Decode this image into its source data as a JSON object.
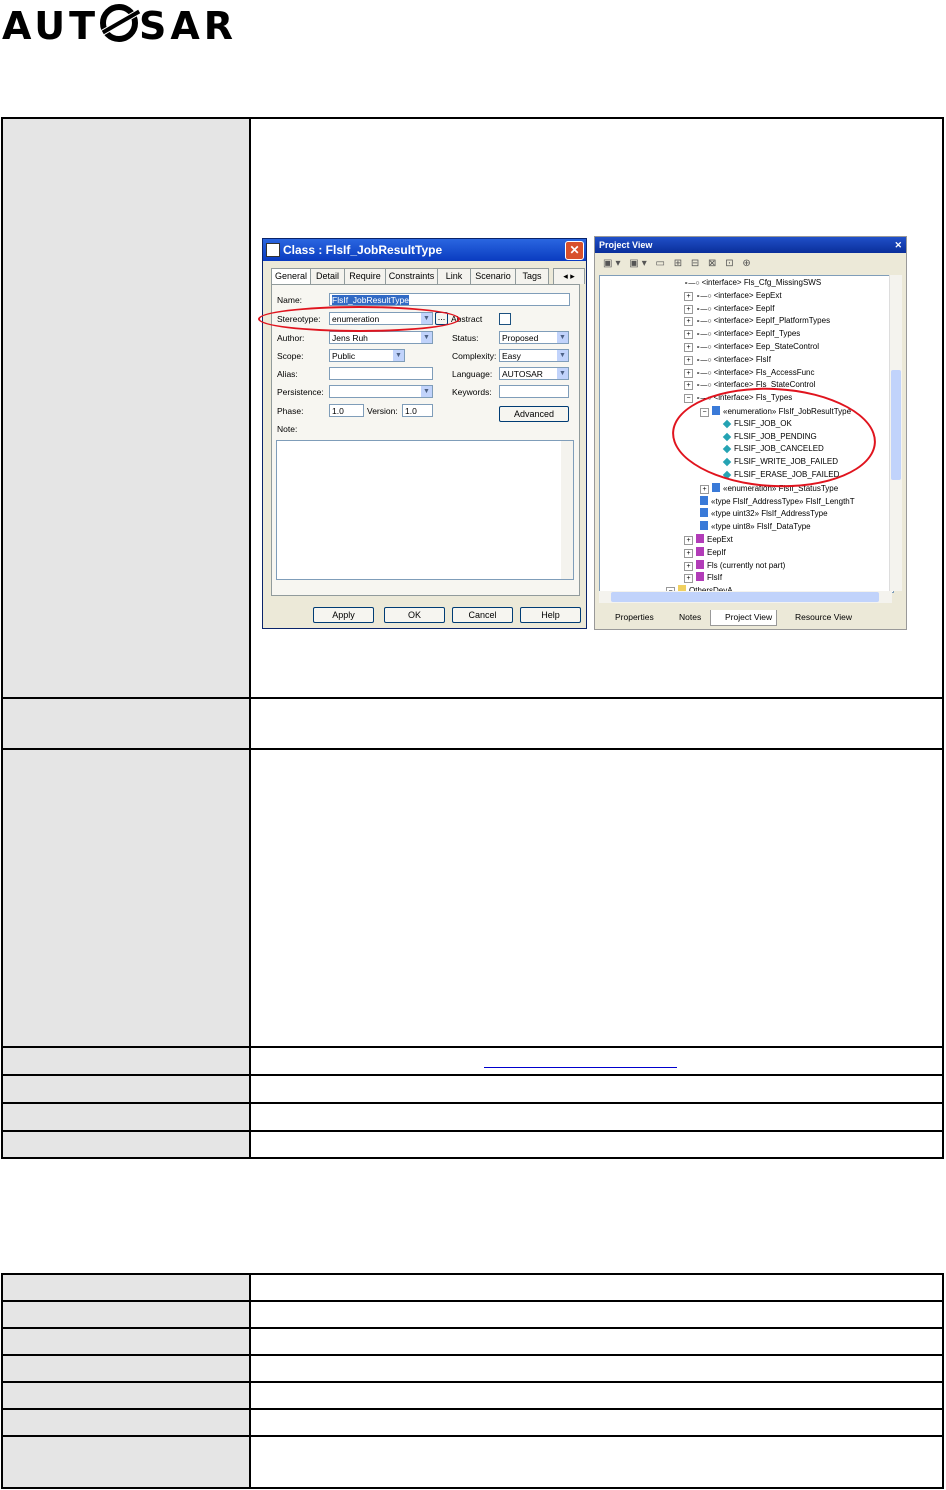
{
  "logo_text": "AUTOSAR",
  "class_dialog": {
    "title": "Class : FlsIf_JobResultType",
    "tabs": [
      "General",
      "Detail",
      "Require",
      "Constraints",
      "Link",
      "Scenario",
      "Tags"
    ],
    "labels": {
      "name": "Name:",
      "stereotype": "Stereotype:",
      "author": "Author:",
      "scope": "Scope:",
      "alias": "Alias:",
      "persistence": "Persistence:",
      "phase": "Phase:",
      "version": "Version:",
      "status": "Status:",
      "complexity": "Complexity:",
      "language": "Language:",
      "keywords": "Keywords:",
      "notes": "Note:",
      "abstract": "Abstract"
    },
    "values": {
      "name": "FlsIf_JobResultType",
      "stereotype": "enumeration",
      "author": "Jens Ruh",
      "scope": "Public",
      "phase": "1.0",
      "version": "1.0",
      "status": "Proposed",
      "complexity": "Easy",
      "language": "AUTOSAR"
    },
    "buttons": {
      "advanced": "Advanced",
      "apply": "Apply",
      "ok": "OK",
      "cancel": "Cancel",
      "help": "Help"
    }
  },
  "project_view": {
    "title": "Project View",
    "items": [
      "<interface> Fls_Cfg_MissingSWS",
      "<interface> EepExt",
      "<interface> EepIf",
      "<interface> EepIf_PlatformTypes",
      "<interface> EepIf_Types",
      "<interface> Eep_StateControl",
      "<interface> FlsIf",
      "<interface> Fls_AccessFunc",
      "<interface> Fls_StateControl",
      "<interface> Fls_Types",
      "«enumeration» FlsIf_JobResultType",
      "FLSIF_JOB_OK",
      "FLSIF_JOB_PENDING",
      "FLSIF_JOB_CANCELED",
      "FLSIF_WRITE_JOB_FAILED",
      "FLSIF_ERASE_JOB_FAILED",
      "«enumeration» FlsIf_StatusType",
      "«type FlsIf_AddressType» FlsIf_LengthT",
      "«type uint32» FlsIf_AddressType",
      "«type uint8» FlsIf_DataType",
      "EepExt",
      "EepIf",
      "Fls (currently not part)",
      "FlsIf",
      "OthersDevA"
    ],
    "bottom_tabs": [
      "Properties",
      "Notes",
      "Project View",
      "Resource View"
    ]
  }
}
